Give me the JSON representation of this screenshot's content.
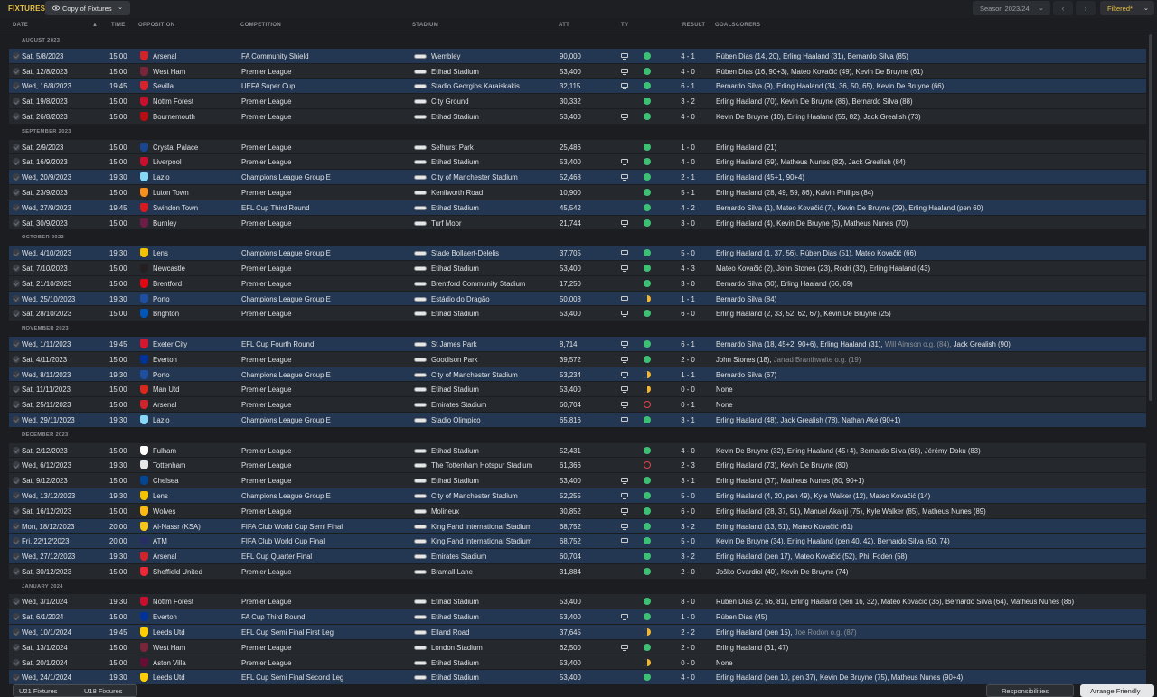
{
  "header": {
    "title": "FIXTURES",
    "view_label": "Copy of Fixtures",
    "season": "Season 2023/24",
    "filter_label": "Filtered*"
  },
  "columns": {
    "date": "DATE",
    "time": "TIME",
    "opposition": "OPPOSITION",
    "competition": "COMPETITION",
    "stadium": "STADIUM",
    "att": "ATT",
    "tv": "TV",
    "result": "RESULT",
    "goalscorers": "GOALSCORERS"
  },
  "colors": {
    "accent": "#e8c143",
    "highlight_row": "#243752",
    "win": "#3dbf74",
    "draw": "#f0b637",
    "loss": "#e0454a"
  },
  "groups": [
    {
      "month": "AUGUST 2023",
      "rows": [
        {
          "date": "Sat, 5/8/2023",
          "time": "15:00",
          "opp": "Arsenal",
          "crest": "#d1232a",
          "comp": "FA Community Shield",
          "stad": "Wembley",
          "att": "90,000",
          "tv": true,
          "outcome": "win",
          "result": "4 - 1",
          "goals": "Rúben Dias (14, 20), Erling Haaland (31), Bernardo Silva (85)",
          "hl": true
        },
        {
          "date": "Sat, 12/8/2023",
          "time": "15:00",
          "opp": "West Ham",
          "crest": "#7a263a",
          "comp": "Premier League",
          "stad": "Etihad Stadium",
          "att": "53,400",
          "tv": true,
          "outcome": "win",
          "result": "4 - 0",
          "goals": "Rúben Dias (16, 90+3), Mateo Kovačić (49), Kevin De Bruyne (61)",
          "hl": false
        },
        {
          "date": "Wed, 16/8/2023",
          "time": "19:45",
          "opp": "Sevilla",
          "crest": "#d6232c",
          "comp": "UEFA Super Cup",
          "stad": "Stadio Georgios Karaiskakis",
          "att": "32,115",
          "tv": true,
          "outcome": "win",
          "result": "6 - 1",
          "goals": "Bernardo Silva (9), Erling Haaland (34, 36, 50, 65), Kevin De Bruyne (66)",
          "hl": true
        },
        {
          "date": "Sat, 19/8/2023",
          "time": "15:00",
          "opp": "Nottm Forest",
          "crest": "#c8102e",
          "comp": "Premier League",
          "stad": "City Ground",
          "att": "30,332",
          "tv": false,
          "outcome": "win",
          "result": "3 - 2",
          "goals": "Erling Haaland (70), Kevin De Bruyne (86), Bernardo Silva (88)",
          "hl": false
        },
        {
          "date": "Sat, 26/8/2023",
          "time": "15:00",
          "opp": "Bournemouth",
          "crest": "#b50e12",
          "comp": "Premier League",
          "stad": "Etihad Stadium",
          "att": "53,400",
          "tv": true,
          "outcome": "win",
          "result": "4 - 0",
          "goals": "Kevin De Bruyne (10), Erling Haaland (55, 82), Jack Grealish (73)",
          "hl": false
        }
      ]
    },
    {
      "month": "SEPTEMBER 2023",
      "rows": [
        {
          "date": "Sat, 2/9/2023",
          "time": "15:00",
          "opp": "Crystal Palace",
          "crest": "#1b458f",
          "comp": "Premier League",
          "stad": "Selhurst Park",
          "att": "25,486",
          "tv": false,
          "outcome": "win",
          "result": "1 - 0",
          "goals": "Erling Haaland (21)",
          "hl": false
        },
        {
          "date": "Sat, 16/9/2023",
          "time": "15:00",
          "opp": "Liverpool",
          "crest": "#c8102e",
          "comp": "Premier League",
          "stad": "Etihad Stadium",
          "att": "53,400",
          "tv": true,
          "outcome": "win",
          "result": "4 - 0",
          "goals": "Erling Haaland (69), Matheus Nunes (82), Jack Grealish (84)",
          "hl": false
        },
        {
          "date": "Wed, 20/9/2023",
          "time": "19:30",
          "opp": "Lazio",
          "crest": "#87d8f7",
          "comp": "Champions League Group E",
          "stad": "City of Manchester Stadium",
          "att": "52,468",
          "tv": true,
          "outcome": "win",
          "result": "2 - 1",
          "goals": "Erling Haaland (45+1, 90+4)",
          "hl": true
        },
        {
          "date": "Sat, 23/9/2023",
          "time": "15:00",
          "opp": "Luton Town",
          "crest": "#f78f1e",
          "comp": "Premier League",
          "stad": "Kenilworth Road",
          "att": "10,900",
          "tv": false,
          "outcome": "win",
          "result": "5 - 1",
          "goals": "Erling Haaland (28, 49, 59, 86), Kalvin Phillips (84)",
          "hl": false
        },
        {
          "date": "Wed, 27/9/2023",
          "time": "19:45",
          "opp": "Swindon Town",
          "crest": "#d71920",
          "comp": "EFL Cup Third Round",
          "stad": "Etihad Stadium",
          "att": "45,542",
          "tv": false,
          "outcome": "win",
          "result": "4 - 2",
          "goals": "Bernardo Silva (1), Mateo Kovačić (7), Kevin De Bruyne (29), Erling Haaland (pen 60)",
          "hl": true
        },
        {
          "date": "Sat, 30/9/2023",
          "time": "15:00",
          "opp": "Burnley",
          "crest": "#6c1d45",
          "comp": "Premier League",
          "stad": "Turf Moor",
          "att": "21,744",
          "tv": true,
          "outcome": "win",
          "result": "3 - 0",
          "goals": "Erling Haaland (4), Kevin De Bruyne (5), Matheus Nunes (70)",
          "hl": false
        }
      ]
    },
    {
      "month": "OCTOBER 2023",
      "rows": [
        {
          "date": "Wed, 4/10/2023",
          "time": "19:30",
          "opp": "Lens",
          "crest": "#f3c300",
          "comp": "Champions League Group E",
          "stad": "Stade Bollaert-Delelis",
          "att": "37,705",
          "tv": true,
          "outcome": "win",
          "result": "5 - 0",
          "goals": "Erling Haaland (1, 37, 56), Rúben Dias (51), Mateo Kovačić (66)",
          "hl": true
        },
        {
          "date": "Sat, 7/10/2023",
          "time": "15:00",
          "opp": "Newcastle",
          "crest": "#241f20",
          "comp": "Premier League",
          "stad": "Etihad Stadium",
          "att": "53,400",
          "tv": true,
          "outcome": "win",
          "result": "4 - 3",
          "goals": "Mateo Kovačić (2), John Stones (23), Rodri (32), Erling Haaland (43)",
          "hl": false
        },
        {
          "date": "Sat, 21/10/2023",
          "time": "15:00",
          "opp": "Brentford",
          "crest": "#e30613",
          "comp": "Premier League",
          "stad": "Brentford Community Stadium",
          "att": "17,250",
          "tv": false,
          "outcome": "win",
          "result": "3 - 0",
          "goals": "Bernardo Silva (30), Erling Haaland (66, 69)",
          "hl": false
        },
        {
          "date": "Wed, 25/10/2023",
          "time": "19:30",
          "opp": "Porto",
          "crest": "#1e4fa0",
          "comp": "Champions League Group E",
          "stad": "Estádio do Dragão",
          "att": "50,003",
          "tv": true,
          "outcome": "draw",
          "result": "1 - 1",
          "goals": "Bernardo Silva (84)",
          "hl": true
        },
        {
          "date": "Sat, 28/10/2023",
          "time": "15:00",
          "opp": "Brighton",
          "crest": "#0057b8",
          "comp": "Premier League",
          "stad": "Etihad Stadium",
          "att": "53,400",
          "tv": true,
          "outcome": "win",
          "result": "6 - 0",
          "goals": "Erling Haaland (2, 33, 52, 62, 67), Kevin De Bruyne (25)",
          "hl": false
        }
      ]
    },
    {
      "month": "NOVEMBER 2023",
      "rows": [
        {
          "date": "Wed, 1/11/2023",
          "time": "19:45",
          "opp": "Exeter City",
          "crest": "#d7172f",
          "comp": "EFL Cup Fourth Round",
          "stad": "St James Park",
          "att": "8,714",
          "tv": true,
          "outcome": "win",
          "result": "6 - 1",
          "goals": "Bernardo Silva (18, 45+2, 90+6), Erling Haaland (31), ",
          "og": "Will Aimson o.g. (84), ",
          "goals2": "Jack Grealish (90)",
          "hl": true
        },
        {
          "date": "Sat, 4/11/2023",
          "time": "15:00",
          "opp": "Everton",
          "crest": "#003399",
          "comp": "Premier League",
          "stad": "Goodison Park",
          "att": "39,572",
          "tv": true,
          "outcome": "win",
          "result": "2 - 0",
          "goals": "John Stones (18), ",
          "og": "Jarrad Branthwaite o.g. (19)",
          "goals2": "",
          "hl": false
        },
        {
          "date": "Wed, 8/11/2023",
          "time": "19:30",
          "opp": "Porto",
          "crest": "#1e4fa0",
          "comp": "Champions League Group E",
          "stad": "City of Manchester Stadium",
          "att": "53,234",
          "tv": true,
          "outcome": "draw",
          "result": "1 - 1",
          "goals": "Bernardo Silva (67)",
          "hl": true
        },
        {
          "date": "Sat, 11/11/2023",
          "time": "15:00",
          "opp": "Man Utd",
          "crest": "#da291c",
          "comp": "Premier League",
          "stad": "Etihad Stadium",
          "att": "53,400",
          "tv": true,
          "outcome": "draw",
          "result": "0 - 0",
          "goals": "None",
          "hl": false
        },
        {
          "date": "Sat, 25/11/2023",
          "time": "15:00",
          "opp": "Arsenal",
          "crest": "#d1232a",
          "comp": "Premier League",
          "stad": "Emirates Stadium",
          "att": "60,704",
          "tv": true,
          "outcome": "loss",
          "result": "0 - 1",
          "goals": "None",
          "hl": false
        },
        {
          "date": "Wed, 29/11/2023",
          "time": "19:30",
          "opp": "Lazio",
          "crest": "#87d8f7",
          "comp": "Champions League Group E",
          "stad": "Stadio Olimpico",
          "att": "65,816",
          "tv": true,
          "outcome": "win",
          "result": "3 - 1",
          "goals": "Erling Haaland (48), Jack Grealish (78), Nathan Aké (90+1)",
          "hl": true
        }
      ]
    },
    {
      "month": "DECEMBER 2023",
      "rows": [
        {
          "date": "Sat, 2/12/2023",
          "time": "15:00",
          "opp": "Fulham",
          "crest": "#ffffff",
          "comp": "Premier League",
          "stad": "Etihad Stadium",
          "att": "52,431",
          "tv": false,
          "outcome": "win",
          "result": "4 - 0",
          "goals": "Kevin De Bruyne (32), Erling Haaland (45+4), Bernardo Silva (68), Jérémy Doku (83)",
          "hl": false
        },
        {
          "date": "Wed, 6/12/2023",
          "time": "19:30",
          "opp": "Tottenham",
          "crest": "#e8e8e8",
          "comp": "Premier League",
          "stad": "The Tottenham Hotspur Stadium",
          "att": "61,366",
          "tv": false,
          "outcome": "loss",
          "result": "2 - 3",
          "goals": "Erling Haaland (73), Kevin De Bruyne (80)",
          "hl": false
        },
        {
          "date": "Sat, 9/12/2023",
          "time": "15:00",
          "opp": "Chelsea",
          "crest": "#034694",
          "comp": "Premier League",
          "stad": "Etihad Stadium",
          "att": "53,400",
          "tv": true,
          "outcome": "win",
          "result": "3 - 1",
          "goals": "Erling Haaland (37), Matheus Nunes (80, 90+1)",
          "hl": false
        },
        {
          "date": "Wed, 13/12/2023",
          "time": "19:30",
          "opp": "Lens",
          "crest": "#f3c300",
          "comp": "Champions League Group E",
          "stad": "City of Manchester Stadium",
          "att": "52,255",
          "tv": true,
          "outcome": "win",
          "result": "5 - 0",
          "goals": "Erling Haaland (4, 20, pen 49), Kyle Walker (12), Mateo Kovačić (14)",
          "hl": true
        },
        {
          "date": "Sat, 16/12/2023",
          "time": "15:00",
          "opp": "Wolves",
          "crest": "#fdb913",
          "comp": "Premier League",
          "stad": "Molineux",
          "att": "30,852",
          "tv": true,
          "outcome": "win",
          "result": "6 - 0",
          "goals": "Erling Haaland (28, 37, 51), Manuel Akanji (75), Kyle Walker (85), Matheus Nunes (89)",
          "hl": false
        },
        {
          "date": "Mon, 18/12/2023",
          "time": "20:00",
          "opp": "Al-Nassr (KSA)",
          "crest": "#f5c518",
          "comp": "FIFA Club World Cup Semi Final",
          "stad": "King Fahd International Stadium",
          "att": "68,752",
          "tv": true,
          "outcome": "win",
          "result": "3 - 2",
          "goals": "Erling Haaland (13, 51), Mateo Kovačić (61)",
          "hl": true
        },
        {
          "date": "Fri, 22/12/2023",
          "time": "20:00",
          "opp": "ATM",
          "crest": "#272e61",
          "comp": "FIFA Club World Cup Final",
          "stad": "King Fahd International Stadium",
          "att": "68,752",
          "tv": true,
          "outcome": "win",
          "result": "5 - 0",
          "goals": "Kevin De Bruyne (34), Erling Haaland (pen 40, 42), Bernardo Silva (50, 74)",
          "hl": true
        },
        {
          "date": "Wed, 27/12/2023",
          "time": "19:30",
          "opp": "Arsenal",
          "crest": "#d1232a",
          "comp": "EFL Cup Quarter Final",
          "stad": "Emirates Stadium",
          "att": "60,704",
          "tv": false,
          "outcome": "win",
          "result": "3 - 2",
          "goals": "Erling Haaland (pen 17), Mateo Kovačić (52), Phil Foden (58)",
          "hl": true
        },
        {
          "date": "Sat, 30/12/2023",
          "time": "15:00",
          "opp": "Sheffield United",
          "crest": "#ee2737",
          "comp": "Premier League",
          "stad": "Bramall Lane",
          "att": "31,884",
          "tv": false,
          "outcome": "win",
          "result": "2 - 0",
          "goals": "Joško Gvardiol (40), Kevin De Bruyne (74)",
          "hl": false
        }
      ]
    },
    {
      "month": "JANUARY 2024",
      "rows": [
        {
          "date": "Wed, 3/1/2024",
          "time": "19:30",
          "opp": "Nottm Forest",
          "crest": "#c8102e",
          "comp": "Premier League",
          "stad": "Etihad Stadium",
          "att": "53,400",
          "tv": false,
          "outcome": "win",
          "result": "8 - 0",
          "goals": "Rúben Dias (2, 56, 81), Erling Haaland (pen 16, 32), Mateo Kovačić (36), Bernardo Silva (64), Matheus Nunes (86)",
          "hl": false
        },
        {
          "date": "Sat, 6/1/2024",
          "time": "15:00",
          "opp": "Everton",
          "crest": "#003399",
          "comp": "FA Cup Third Round",
          "stad": "Etihad Stadium",
          "att": "53,400",
          "tv": true,
          "outcome": "win",
          "result": "1 - 0",
          "goals": "Rúben Dias (45)",
          "hl": true
        },
        {
          "date": "Wed, 10/1/2024",
          "time": "19:45",
          "opp": "Leeds Utd",
          "crest": "#ffcd00",
          "comp": "EFL Cup Semi Final First Leg",
          "stad": "Elland Road",
          "att": "37,645",
          "tv": false,
          "outcome": "draw",
          "result": "2 - 2",
          "goals": "Erling Haaland (pen 15), ",
          "og": "Joe Rodon o.g. (87)",
          "goals2": "",
          "hl": true
        },
        {
          "date": "Sat, 13/1/2024",
          "time": "15:00",
          "opp": "West Ham",
          "crest": "#7a263a",
          "comp": "Premier League",
          "stad": "London Stadium",
          "att": "62,500",
          "tv": true,
          "outcome": "win",
          "result": "2 - 0",
          "goals": "Erling Haaland (31, 47)",
          "hl": false
        },
        {
          "date": "Sat, 20/1/2024",
          "time": "15:00",
          "opp": "Aston Villa",
          "crest": "#670e36",
          "comp": "Premier League",
          "stad": "Etihad Stadium",
          "att": "53,400",
          "tv": false,
          "outcome": "draw",
          "result": "0 - 0",
          "goals": "None",
          "hl": false
        },
        {
          "date": "Wed, 24/1/2024",
          "time": "19:30",
          "opp": "Leeds Utd",
          "crest": "#ffcd00",
          "comp": "EFL Cup Semi Final Second Leg",
          "stad": "Etihad Stadium",
          "att": "53,400",
          "tv": false,
          "outcome": "win",
          "result": "4 - 0",
          "goals": "Erling Haaland (pen 10, pen 37), Kevin De Bruyne (75), Matheus Nunes (90+4)",
          "hl": true
        }
      ]
    }
  ],
  "footer": {
    "u21": "U21 Fixtures",
    "u18": "U18 Fixtures",
    "responsibilities": "Responsibilities",
    "arrange": "Arrange Friendly"
  }
}
